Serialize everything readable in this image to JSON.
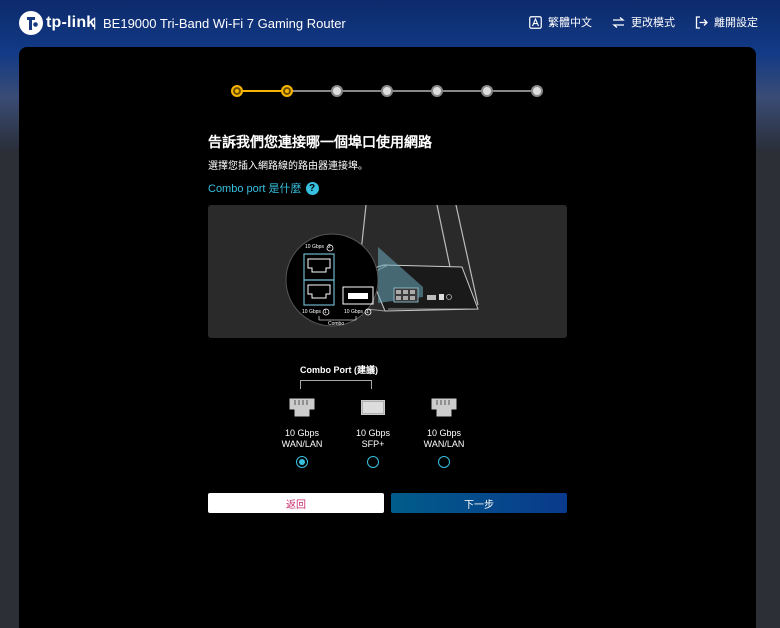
{
  "header": {
    "logo_text": "tp-link",
    "separator": "|",
    "title": "BE19000 Tri-Band Wi-Fi 7 Gaming Router",
    "actions": [
      {
        "label": "繁體中文",
        "icon": "language-icon"
      },
      {
        "label": "更改模式",
        "icon": "switch-mode-icon"
      },
      {
        "label": "離開設定",
        "icon": "exit-icon"
      }
    ]
  },
  "stepper": {
    "total_steps": 7,
    "current_step": 2
  },
  "main": {
    "title": "告訴我們您連接哪一個埠口使用網路",
    "subtitle": "選擇您插入網路線的路由器連接埠。",
    "combo_link": "Combo port 是什麼",
    "help_icon": "?"
  },
  "diagram": {
    "top_label": "10 Gbps",
    "top_badge": "2",
    "bottom_left_label": "10 Gbps",
    "bottom_left_badge": "1",
    "bottom_right_label": "10 Gbps",
    "bottom_right_badge": "1",
    "combo_text": "Combo"
  },
  "ports": {
    "combo_label": "Combo Port (建議)",
    "options": [
      {
        "speed": "10 Gbps",
        "type": "WAN/LAN",
        "icon": "ethernet-port-icon",
        "selected": true
      },
      {
        "speed": "10 Gbps",
        "type": "SFP+",
        "icon": "sfp-port-icon",
        "selected": false
      },
      {
        "speed": "10 Gbps",
        "type": "WAN/LAN",
        "icon": "ethernet-port-icon",
        "selected": false
      }
    ]
  },
  "buttons": {
    "back": "返回",
    "next": "下一步"
  },
  "colors": {
    "accent": "#37c0e0",
    "step_active": "#f5b400",
    "back_text": "#c8266e"
  }
}
